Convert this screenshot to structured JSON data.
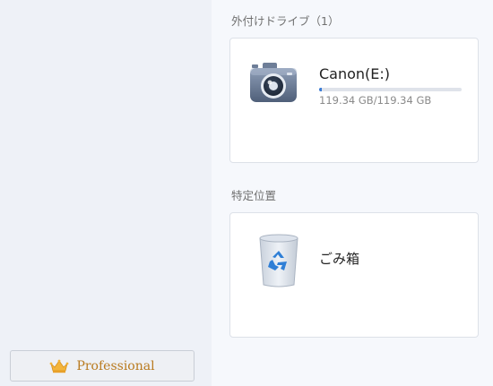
{
  "sidebar": {
    "pro_button_label": "Professional"
  },
  "sections": {
    "external": {
      "title": "外付けドライブ（1）",
      "drive": {
        "name": "Canon(E:)",
        "size": "119.34 GB/119.34 GB",
        "used_fraction": 0.02,
        "icon": "camera-icon"
      }
    },
    "special": {
      "title": "特定位置",
      "item": {
        "name": "ごみ箱",
        "icon": "recycle-bin-icon"
      }
    }
  },
  "colors": {
    "accent": "#3a7bd5",
    "pro_gold": "#b97a1e"
  }
}
